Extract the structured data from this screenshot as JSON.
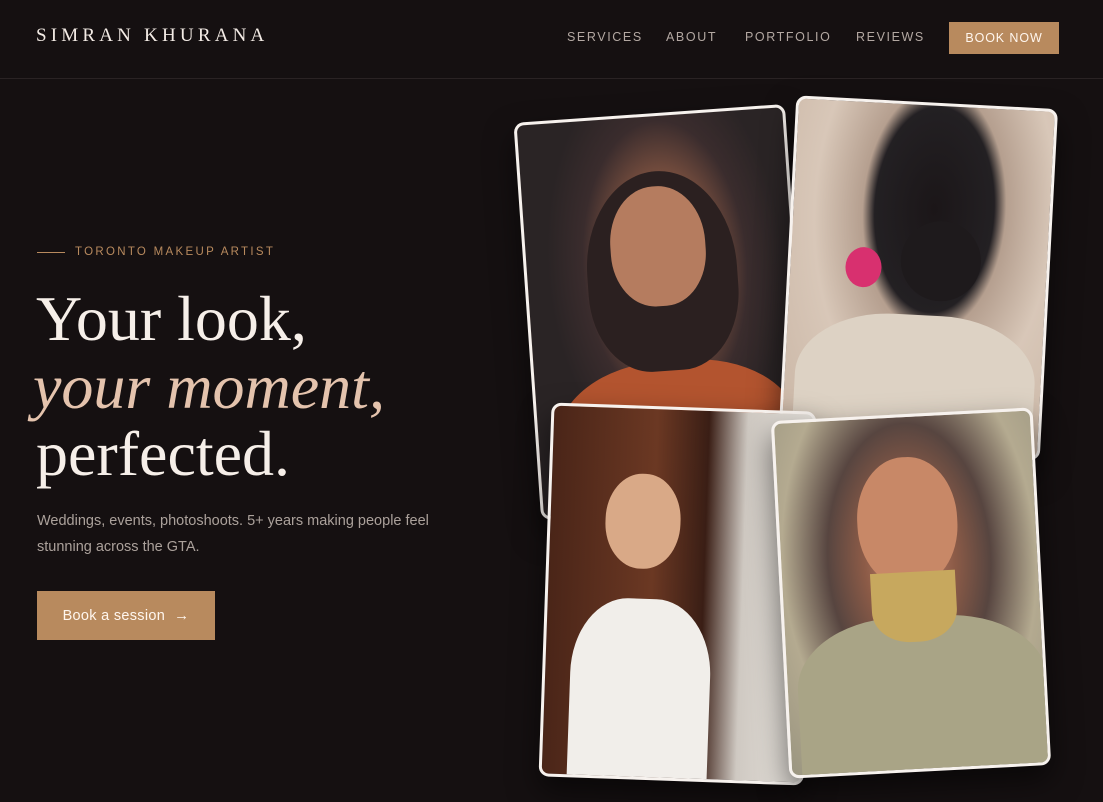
{
  "header": {
    "logo": "SIMRAN KHURANA",
    "nav": [
      "SERVICES",
      "ABOUT",
      "PORTFOLIO",
      "REVIEWS"
    ],
    "book_now": "BOOK NOW"
  },
  "hero": {
    "eyebrow": "TORONTO MAKEUP ARTIST",
    "headline_line1": "Your look,",
    "headline_line2": "your moment,",
    "headline_line3": "perfected.",
    "subtitle": "Weddings, events, photoshoots. 5+ years making people feel stunning across the GTA.",
    "cta_label": "Book a session",
    "cta_arrow": "→"
  },
  "gallery": {
    "photos": [
      "bride-orange-lehenga-photo",
      "bridal-bun-pink-flower-photo",
      "bride-white-gown-photo",
      "bride-gold-jewelry-photo"
    ]
  },
  "colors": {
    "background": "#151011",
    "accent": "#b88a5e",
    "headline_italic": "#e4c3ad",
    "text_muted": "#aba19b"
  }
}
